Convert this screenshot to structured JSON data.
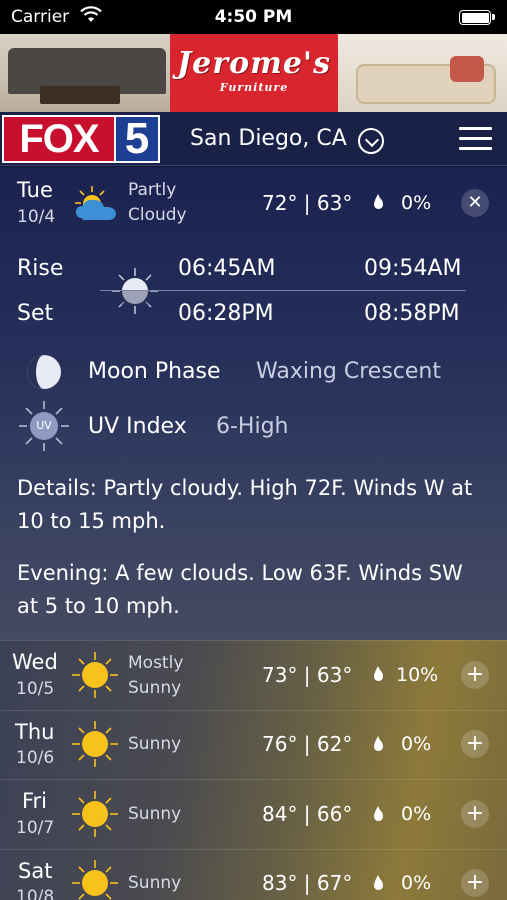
{
  "status_bar": {
    "carrier": "Carrier",
    "time": "4:50 PM"
  },
  "ad": {
    "brand": "Jerome's",
    "sub": "Furniture"
  },
  "header": {
    "logo_text": "FOX",
    "logo_number": "5",
    "location": "San Diego, CA"
  },
  "today": {
    "day": "Tue",
    "date": "10/4",
    "condition_line1": "Partly",
    "condition_line2": "Cloudy",
    "temps": "72° | 63°",
    "precip": "0%",
    "rise_label": "Rise",
    "set_label": "Set",
    "sunrise": "06:45AM",
    "sunset": "06:28PM",
    "moonrise": "09:54AM",
    "moonset": "08:58PM",
    "moon_phase_label": "Moon Phase",
    "moon_phase_value": "Waxing Crescent",
    "uv_badge": "UV",
    "uv_label": "UV Index",
    "uv_value": "6-High",
    "details": "Details: Partly cloudy. High 72F. Winds W at 10 to 15 mph.",
    "evening": "Evening: A few clouds. Low 63F. Winds SW at 5 to 10 mph."
  },
  "forecast": [
    {
      "day": "Wed",
      "date": "10/5",
      "condition_line1": "Mostly",
      "condition_line2": "Sunny",
      "temps": "73° | 63°",
      "precip": "10%"
    },
    {
      "day": "Thu",
      "date": "10/6",
      "condition_line1": "Sunny",
      "condition_line2": "",
      "temps": "76° | 62°",
      "precip": "0%"
    },
    {
      "day": "Fri",
      "date": "10/7",
      "condition_line1": "Sunny",
      "condition_line2": "",
      "temps": "84° | 66°",
      "precip": "0%"
    },
    {
      "day": "Sat",
      "date": "10/8",
      "condition_line1": "Sunny",
      "condition_line2": "",
      "temps": "83° | 67°",
      "precip": "0%"
    }
  ],
  "icons": {
    "today": "partly-cloudy-icon",
    "sun": "sun-icon",
    "moon": "crescent-moon-icon",
    "moon_phase": "moon-phase-icon",
    "uv": "uv-index-icon",
    "forecast": "sunny-icon"
  },
  "colors": {
    "sun": "#f7c21a",
    "fox_red": "#c8102e",
    "fox_blue": "#1c3f94"
  }
}
